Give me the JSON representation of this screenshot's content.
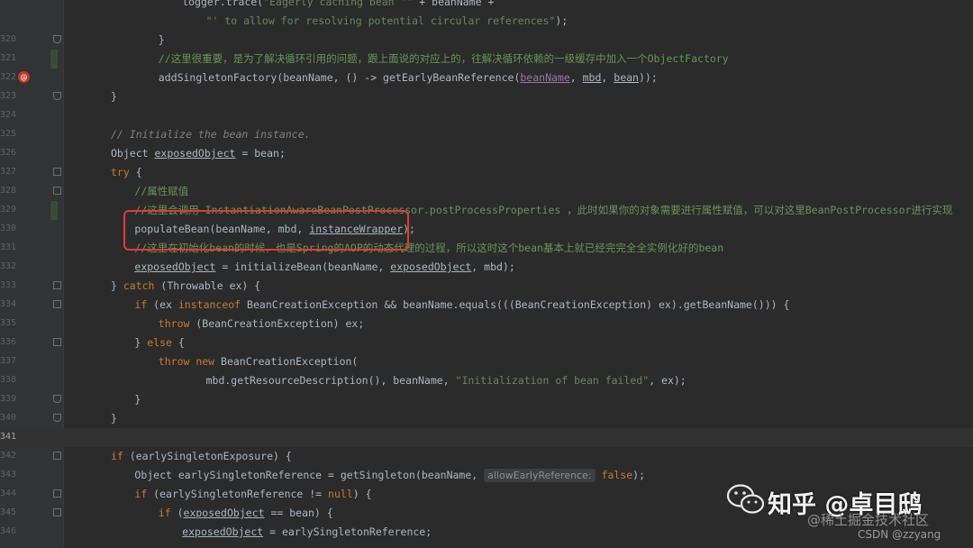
{
  "editor": {
    "lines": [
      {
        "num": "",
        "tokens": [
          {
            "t": "logger.trace(",
            "c": "plain"
          },
          {
            "t": "\"Eagerly caching bean '\"",
            "c": "str"
          },
          {
            "t": " + beanName +",
            "c": "plain"
          }
        ],
        "indent": 6
      },
      {
        "num": "",
        "tokens": [
          {
            "t": "\"' to allow for resolving potential circular references\"",
            "c": "str"
          },
          {
            "t": ");",
            "c": "plain"
          }
        ],
        "indent": 8
      },
      {
        "num": "320",
        "tokens": [
          {
            "t": "}",
            "c": "plain"
          }
        ],
        "indent": 4,
        "fold": "end"
      },
      {
        "num": "321",
        "tokens": [
          {
            "t": "//这里很重要，是为了解决循环引用的问题，跟上面说的对应上的，往解决循环依赖的一级缓存中加入一个ObjectFactory",
            "c": "cmtg"
          }
        ],
        "indent": 4,
        "change": true
      },
      {
        "num": "322",
        "tokens": [
          {
            "t": "addSingletonFactory(beanName, () -> getEarlyBeanReference(",
            "c": "plain"
          },
          {
            "t": "beanName",
            "c": "fld und"
          },
          {
            "t": ", ",
            "c": "plain"
          },
          {
            "t": "mbd",
            "c": "plain und"
          },
          {
            "t": ", ",
            "c": "plain"
          },
          {
            "t": "bean",
            "c": "plain und"
          },
          {
            "t": "));",
            "c": "plain"
          }
        ],
        "indent": 4,
        "bp": true
      },
      {
        "num": "323",
        "tokens": [
          {
            "t": "}",
            "c": "plain"
          }
        ],
        "indent": 0,
        "fold": "end"
      },
      {
        "num": "324",
        "tokens": [],
        "indent": 0
      },
      {
        "num": "325",
        "tokens": [
          {
            "t": "// Initialize the bean instance.",
            "c": "cmt"
          }
        ],
        "indent": 0
      },
      {
        "num": "326",
        "tokens": [
          {
            "t": "Object ",
            "c": "plain"
          },
          {
            "t": "exposedObject",
            "c": "plain und"
          },
          {
            "t": " = bean;",
            "c": "plain"
          }
        ],
        "indent": 0
      },
      {
        "num": "327",
        "tokens": [
          {
            "t": "try",
            "c": "kw"
          },
          {
            "t": " {",
            "c": "plain"
          }
        ],
        "indent": 0,
        "fold": "start"
      },
      {
        "num": "328",
        "tokens": [
          {
            "t": "//属性赋值",
            "c": "cmtg"
          }
        ],
        "indent": 2,
        "fold": "start"
      },
      {
        "num": "329",
        "tokens": [
          {
            "t": "//这里会调用 InstantiationAwareBeanPostProcessor.postProcessProperties ，此时如果你的对象需要进行属性赋值，可以对这里BeanPostProcessor进行实现",
            "c": "cmtg"
          }
        ],
        "indent": 2,
        "change": true
      },
      {
        "num": "330",
        "tokens": [
          {
            "t": "populateBean(beanName, mbd, ",
            "c": "plain"
          },
          {
            "t": "instanceWrapper",
            "c": "plain und"
          },
          {
            "t": ");",
            "c": "plain"
          }
        ],
        "indent": 2
      },
      {
        "num": "331",
        "tokens": [
          {
            "t": "//这里在初始化bean的时候，也是Spring的AOP的动态代理的过程，所以这时这个bean基本上就已经完完全全实例化好的bean",
            "c": "cmtg"
          }
        ],
        "indent": 2
      },
      {
        "num": "332",
        "tokens": [
          {
            "t": "exposedObject",
            "c": "plain und"
          },
          {
            "t": " = initializeBean(beanName, ",
            "c": "plain"
          },
          {
            "t": "exposedObject",
            "c": "plain und"
          },
          {
            "t": ", mbd);",
            "c": "plain"
          }
        ],
        "indent": 2
      },
      {
        "num": "333",
        "tokens": [
          {
            "t": "} ",
            "c": "plain"
          },
          {
            "t": "catch",
            "c": "kw"
          },
          {
            "t": " (Throwable ex) {",
            "c": "plain"
          }
        ],
        "indent": 0,
        "fold": "start"
      },
      {
        "num": "334",
        "tokens": [
          {
            "t": "if",
            "c": "kw"
          },
          {
            "t": " (ex ",
            "c": "plain"
          },
          {
            "t": "instanceof",
            "c": "kw"
          },
          {
            "t": " BeanCreationException && beanName.equals(((BeanCreationException) ex).getBeanName())) {",
            "c": "plain"
          }
        ],
        "indent": 2,
        "fold": "start"
      },
      {
        "num": "335",
        "tokens": [
          {
            "t": "throw",
            "c": "kw"
          },
          {
            "t": " (BeanCreationException) ex;",
            "c": "plain"
          }
        ],
        "indent": 4
      },
      {
        "num": "336",
        "tokens": [
          {
            "t": "} ",
            "c": "plain"
          },
          {
            "t": "else",
            "c": "kw"
          },
          {
            "t": " {",
            "c": "plain"
          }
        ],
        "indent": 2,
        "fold": "start"
      },
      {
        "num": "337",
        "tokens": [
          {
            "t": "throw new",
            "c": "kw"
          },
          {
            "t": " BeanCreationException(",
            "c": "plain"
          }
        ],
        "indent": 4
      },
      {
        "num": "338",
        "tokens": [
          {
            "t": "mbd.getResourceDescription(), beanName, ",
            "c": "plain"
          },
          {
            "t": "\"Initialization of bean failed\"",
            "c": "str"
          },
          {
            "t": ", ex);",
            "c": "plain"
          }
        ],
        "indent": 8
      },
      {
        "num": "339",
        "tokens": [
          {
            "t": "}",
            "c": "plain"
          }
        ],
        "indent": 2,
        "fold": "end"
      },
      {
        "num": "340",
        "tokens": [
          {
            "t": "}",
            "c": "plain"
          }
        ],
        "indent": 0,
        "fold": "end"
      },
      {
        "num": "341",
        "tokens": [],
        "indent": 0,
        "current": true
      },
      {
        "num": "342",
        "tokens": [
          {
            "t": "if",
            "c": "kw"
          },
          {
            "t": " (earlySingletonExposure) {",
            "c": "plain"
          }
        ],
        "indent": 0,
        "fold": "start"
      },
      {
        "num": "343",
        "tokens": [
          {
            "t": "Object earlySingletonReference = getSingleton(beanName, ",
            "c": "plain"
          },
          {
            "t": "allowEarlyReference:",
            "c": "hint"
          },
          {
            "t": " ",
            "c": "plain"
          },
          {
            "t": "false",
            "c": "kw"
          },
          {
            "t": ");",
            "c": "plain"
          }
        ],
        "indent": 2
      },
      {
        "num": "344",
        "tokens": [
          {
            "t": "if",
            "c": "kw"
          },
          {
            "t": " (earlySingletonReference != ",
            "c": "plain"
          },
          {
            "t": "null",
            "c": "kw"
          },
          {
            "t": ") {",
            "c": "plain"
          }
        ],
        "indent": 2,
        "fold": "start"
      },
      {
        "num": "345",
        "tokens": [
          {
            "t": "if",
            "c": "kw"
          },
          {
            "t": " (",
            "c": "plain"
          },
          {
            "t": "exposedObject",
            "c": "plain und"
          },
          {
            "t": " == bean) {",
            "c": "plain"
          }
        ],
        "indent": 4,
        "fold": "start"
      },
      {
        "num": "346",
        "tokens": [
          {
            "t": "exposedObject",
            "c": "plain und"
          },
          {
            "t": " = earlySingletonReference;",
            "c": "plain"
          }
        ],
        "indent": 6
      }
    ]
  },
  "watermark": {
    "brand_text": "知乎 @卓目鸱",
    "site_text": "@稀土掘金技术社区",
    "csdn_text": "CSDN @zzyang",
    "logo": "wechat-logo-icon"
  },
  "colors": {
    "highlight_box": "#e53935",
    "background": "#2b2b2b"
  }
}
